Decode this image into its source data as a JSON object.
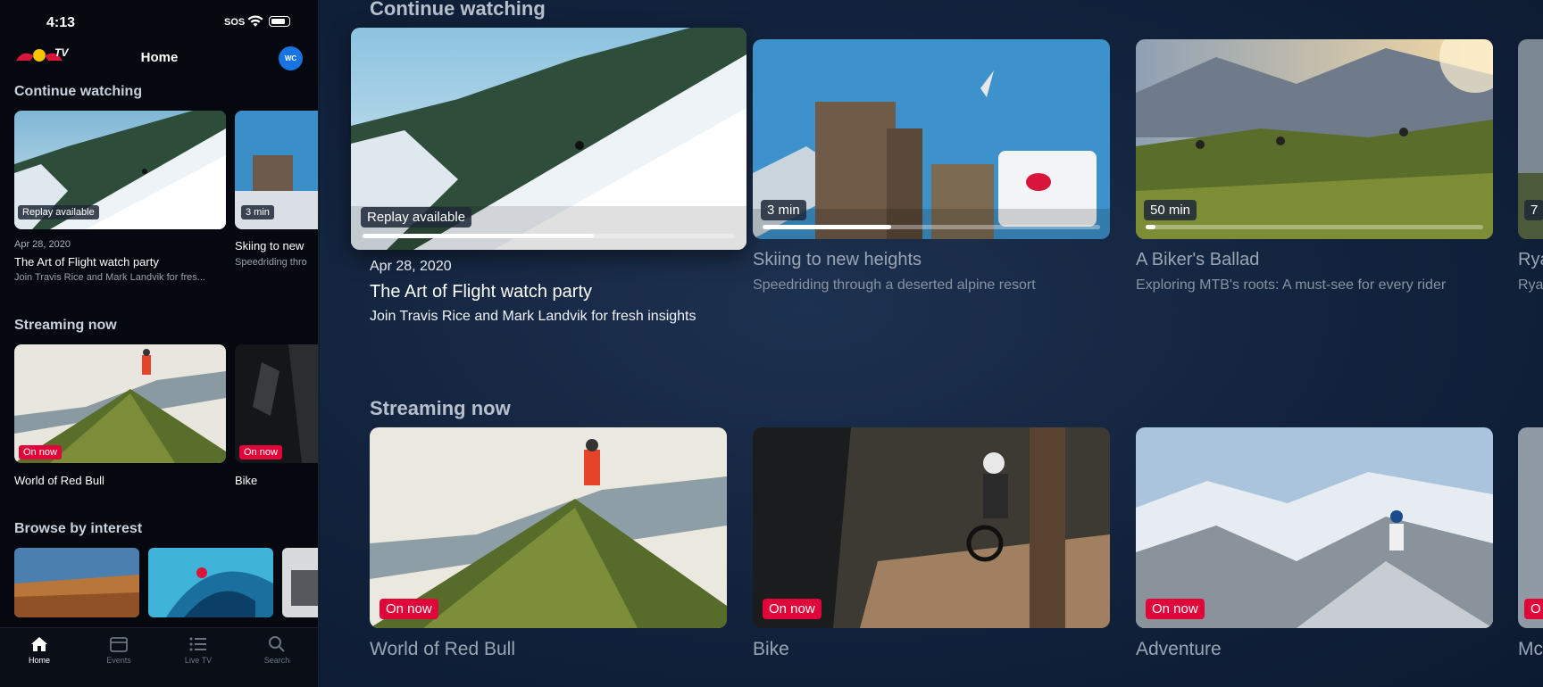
{
  "phone": {
    "status": {
      "time": "4:13",
      "sos": "SOS"
    },
    "header": {
      "logo_text": "TV",
      "title": "Home",
      "avatar_initials": "WC"
    },
    "continue_watching": {
      "title": "Continue watching",
      "items": [
        {
          "tag": "Replay available",
          "date": "Apr 28, 2020",
          "title": "The Art of Flight watch party",
          "subtitle": "Join Travis Rice and Mark Landvik for fres..."
        },
        {
          "tag": "3 min",
          "date": "",
          "title": "Skiing to new",
          "subtitle": "Speedriding thro"
        }
      ]
    },
    "streaming_now": {
      "title": "Streaming now",
      "items": [
        {
          "tag": "On now",
          "title": "World of Red Bull"
        },
        {
          "tag": "On now",
          "title": "Bike"
        }
      ]
    },
    "browse": {
      "title": "Browse by interest"
    },
    "tabs": [
      {
        "label": "Home",
        "icon": "home-icon"
      },
      {
        "label": "Events",
        "icon": "calendar-icon"
      },
      {
        "label": "Live TV",
        "icon": "list-icon"
      },
      {
        "label": "Search",
        "icon": "search-icon"
      }
    ]
  },
  "tv": {
    "continue_watching": {
      "title": "Continue watching",
      "items": [
        {
          "tag": "Replay available",
          "progress": 0.62,
          "date": "Apr 28, 2020",
          "title": "The Art of Flight watch party",
          "subtitle": "Join Travis Rice and Mark Landvik for fresh insights"
        },
        {
          "tag": "3 min",
          "progress": 0.38,
          "title": "Skiing to new heights",
          "subtitle": "Speedriding through a deserted alpine resort"
        },
        {
          "tag": "50 min",
          "progress": 0.03,
          "title": "A Biker's Ballad",
          "subtitle": "Exploring MTB's roots: A must-see for every rider"
        },
        {
          "tag": "7",
          "title": "Rya",
          "subtitle": "Rya"
        }
      ]
    },
    "streaming_now": {
      "title": "Streaming now",
      "items": [
        {
          "tag": "On now",
          "title": "World of Red Bull"
        },
        {
          "tag": "On now",
          "title": "Bike"
        },
        {
          "tag": "On now",
          "title": "Adventure"
        },
        {
          "tag": "O",
          "title": "Mc"
        }
      ]
    },
    "colors": {
      "accent_red": "#e1063a",
      "background": "#12223c"
    }
  }
}
